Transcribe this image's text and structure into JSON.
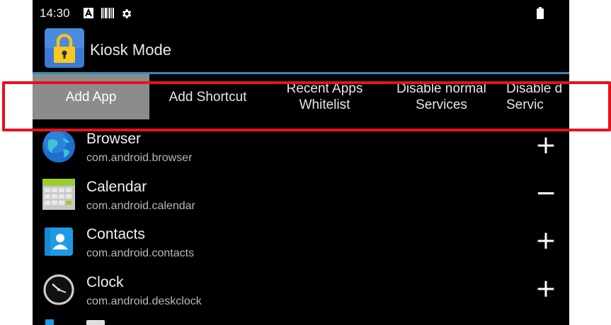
{
  "status_bar": {
    "time": "14:30",
    "icons": [
      "a-box-icon",
      "barcode-icon",
      "settings-gear-icon",
      "battery-icon"
    ]
  },
  "action_bar": {
    "title": "Kiosk Mode",
    "icon": "lock-icon",
    "icon_color": "#3a7bd5"
  },
  "tabs": [
    {
      "label": "Add App",
      "active": true
    },
    {
      "label": "Add Shortcut",
      "active": false
    },
    {
      "label": "Recent Apps\nWhitelist",
      "active": false
    },
    {
      "label": "Disable normal\nServices",
      "active": false
    },
    {
      "label": "Disable d\nServic",
      "active": false
    }
  ],
  "apps": [
    {
      "name": "Browser",
      "package": "com.android.browser",
      "action": "+",
      "icon": "globe-icon"
    },
    {
      "name": "Calendar",
      "package": "com.android.calendar",
      "action": "−",
      "icon": "calendar-icon"
    },
    {
      "name": "Contacts",
      "package": "com.android.contacts",
      "action": "+",
      "icon": "contacts-icon"
    },
    {
      "name": "Clock",
      "package": "com.android.deskclock",
      "action": "+",
      "icon": "clock-icon"
    }
  ],
  "colors": {
    "accent": "#2d8fb3",
    "active_tab": "#8c8c8c",
    "highlight": "#e8111b"
  }
}
